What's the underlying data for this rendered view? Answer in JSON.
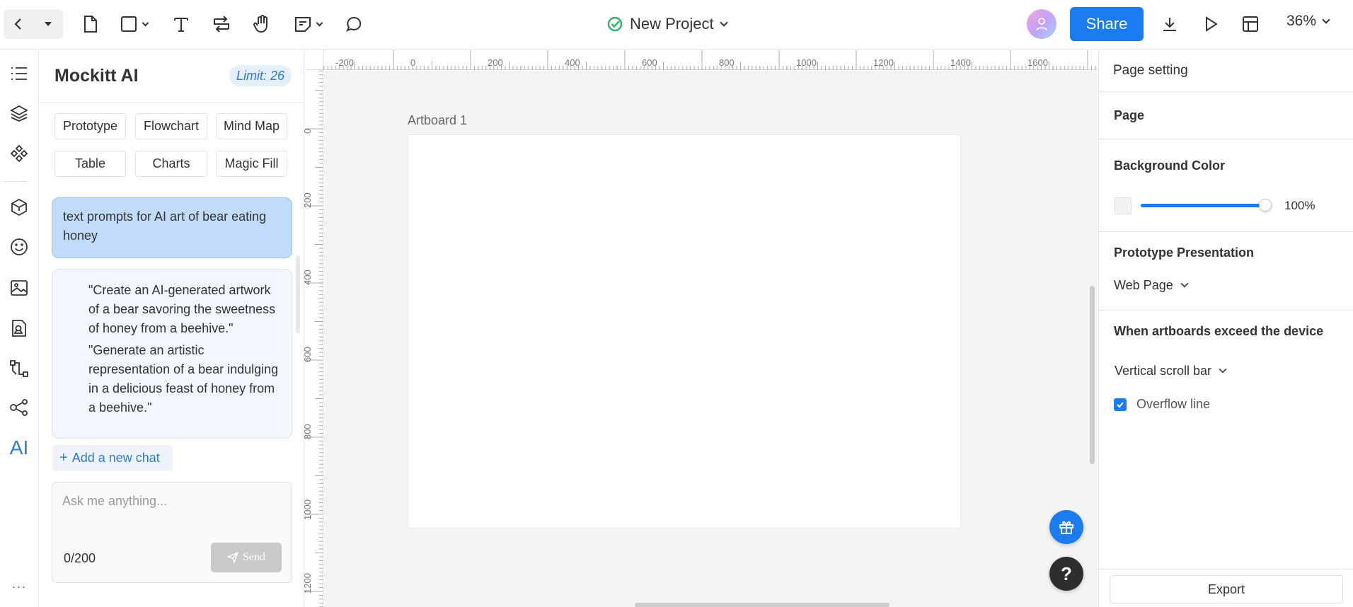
{
  "topbar": {
    "project_title": "New Project",
    "share_label": "Share",
    "zoom_level": "36%"
  },
  "ai_panel": {
    "title": "Mockitt AI",
    "limit": "Limit: 26",
    "chips": [
      "Prototype",
      "Flowchart",
      "Mind Map",
      "Table",
      "Charts",
      "Magic Fill"
    ],
    "user_message": "text prompts for AI art of bear eating honey",
    "responses": [
      "\"Create an AI-generated artwork of a bear savoring the sweetness of honey from a beehive.\"",
      "\"Generate an artistic representation of a bear indulging in a delicious feast of honey from a beehive.\""
    ],
    "add_chat_label": "Add a new chat",
    "input_placeholder": "Ask me anything...",
    "char_counter": "0/200",
    "send_label": "Send"
  },
  "ruler": {
    "top_labels": [
      "-200",
      "0",
      "200",
      "400",
      "600",
      "800",
      "1000",
      "1200",
      "1400",
      "1600"
    ],
    "left_labels": [
      "0",
      "200",
      "400",
      "600",
      "800",
      "1000",
      "1200"
    ]
  },
  "canvas": {
    "artboard_label": "Artboard 1"
  },
  "right_panel": {
    "header": "Page setting",
    "page_heading": "Page",
    "bg_color_heading": "Background Color",
    "opacity": "100%",
    "opacity_fraction": 1.0,
    "presentation_heading": "Prototype Presentation",
    "presentation_value": "Web Page",
    "exceed_heading": "When artboards exceed the device",
    "exceed_value": "Vertical scroll bar",
    "overflow_label": "Overflow line",
    "overflow_checked": true,
    "export_label": "Export"
  },
  "colors": {
    "accent": "#1a7cf0",
    "user_bubble": "#c1dcfa",
    "canvas_bg": "#f4f4f4"
  },
  "icons": {
    "topbar": [
      "back-arrow-icon",
      "page-icon",
      "rectangle-icon",
      "text-icon",
      "connector-icon",
      "hand-icon",
      "note-icon",
      "comment-icon",
      "download-icon",
      "play-icon",
      "layout-icon"
    ],
    "rail": [
      "outline-icon",
      "layers-icon",
      "components-icon",
      "widgets-icon",
      "emoji-icon",
      "image-icon",
      "assets-icon",
      "flow-icon",
      "mindmap-icon",
      "ai-icon",
      "more-icon"
    ]
  }
}
